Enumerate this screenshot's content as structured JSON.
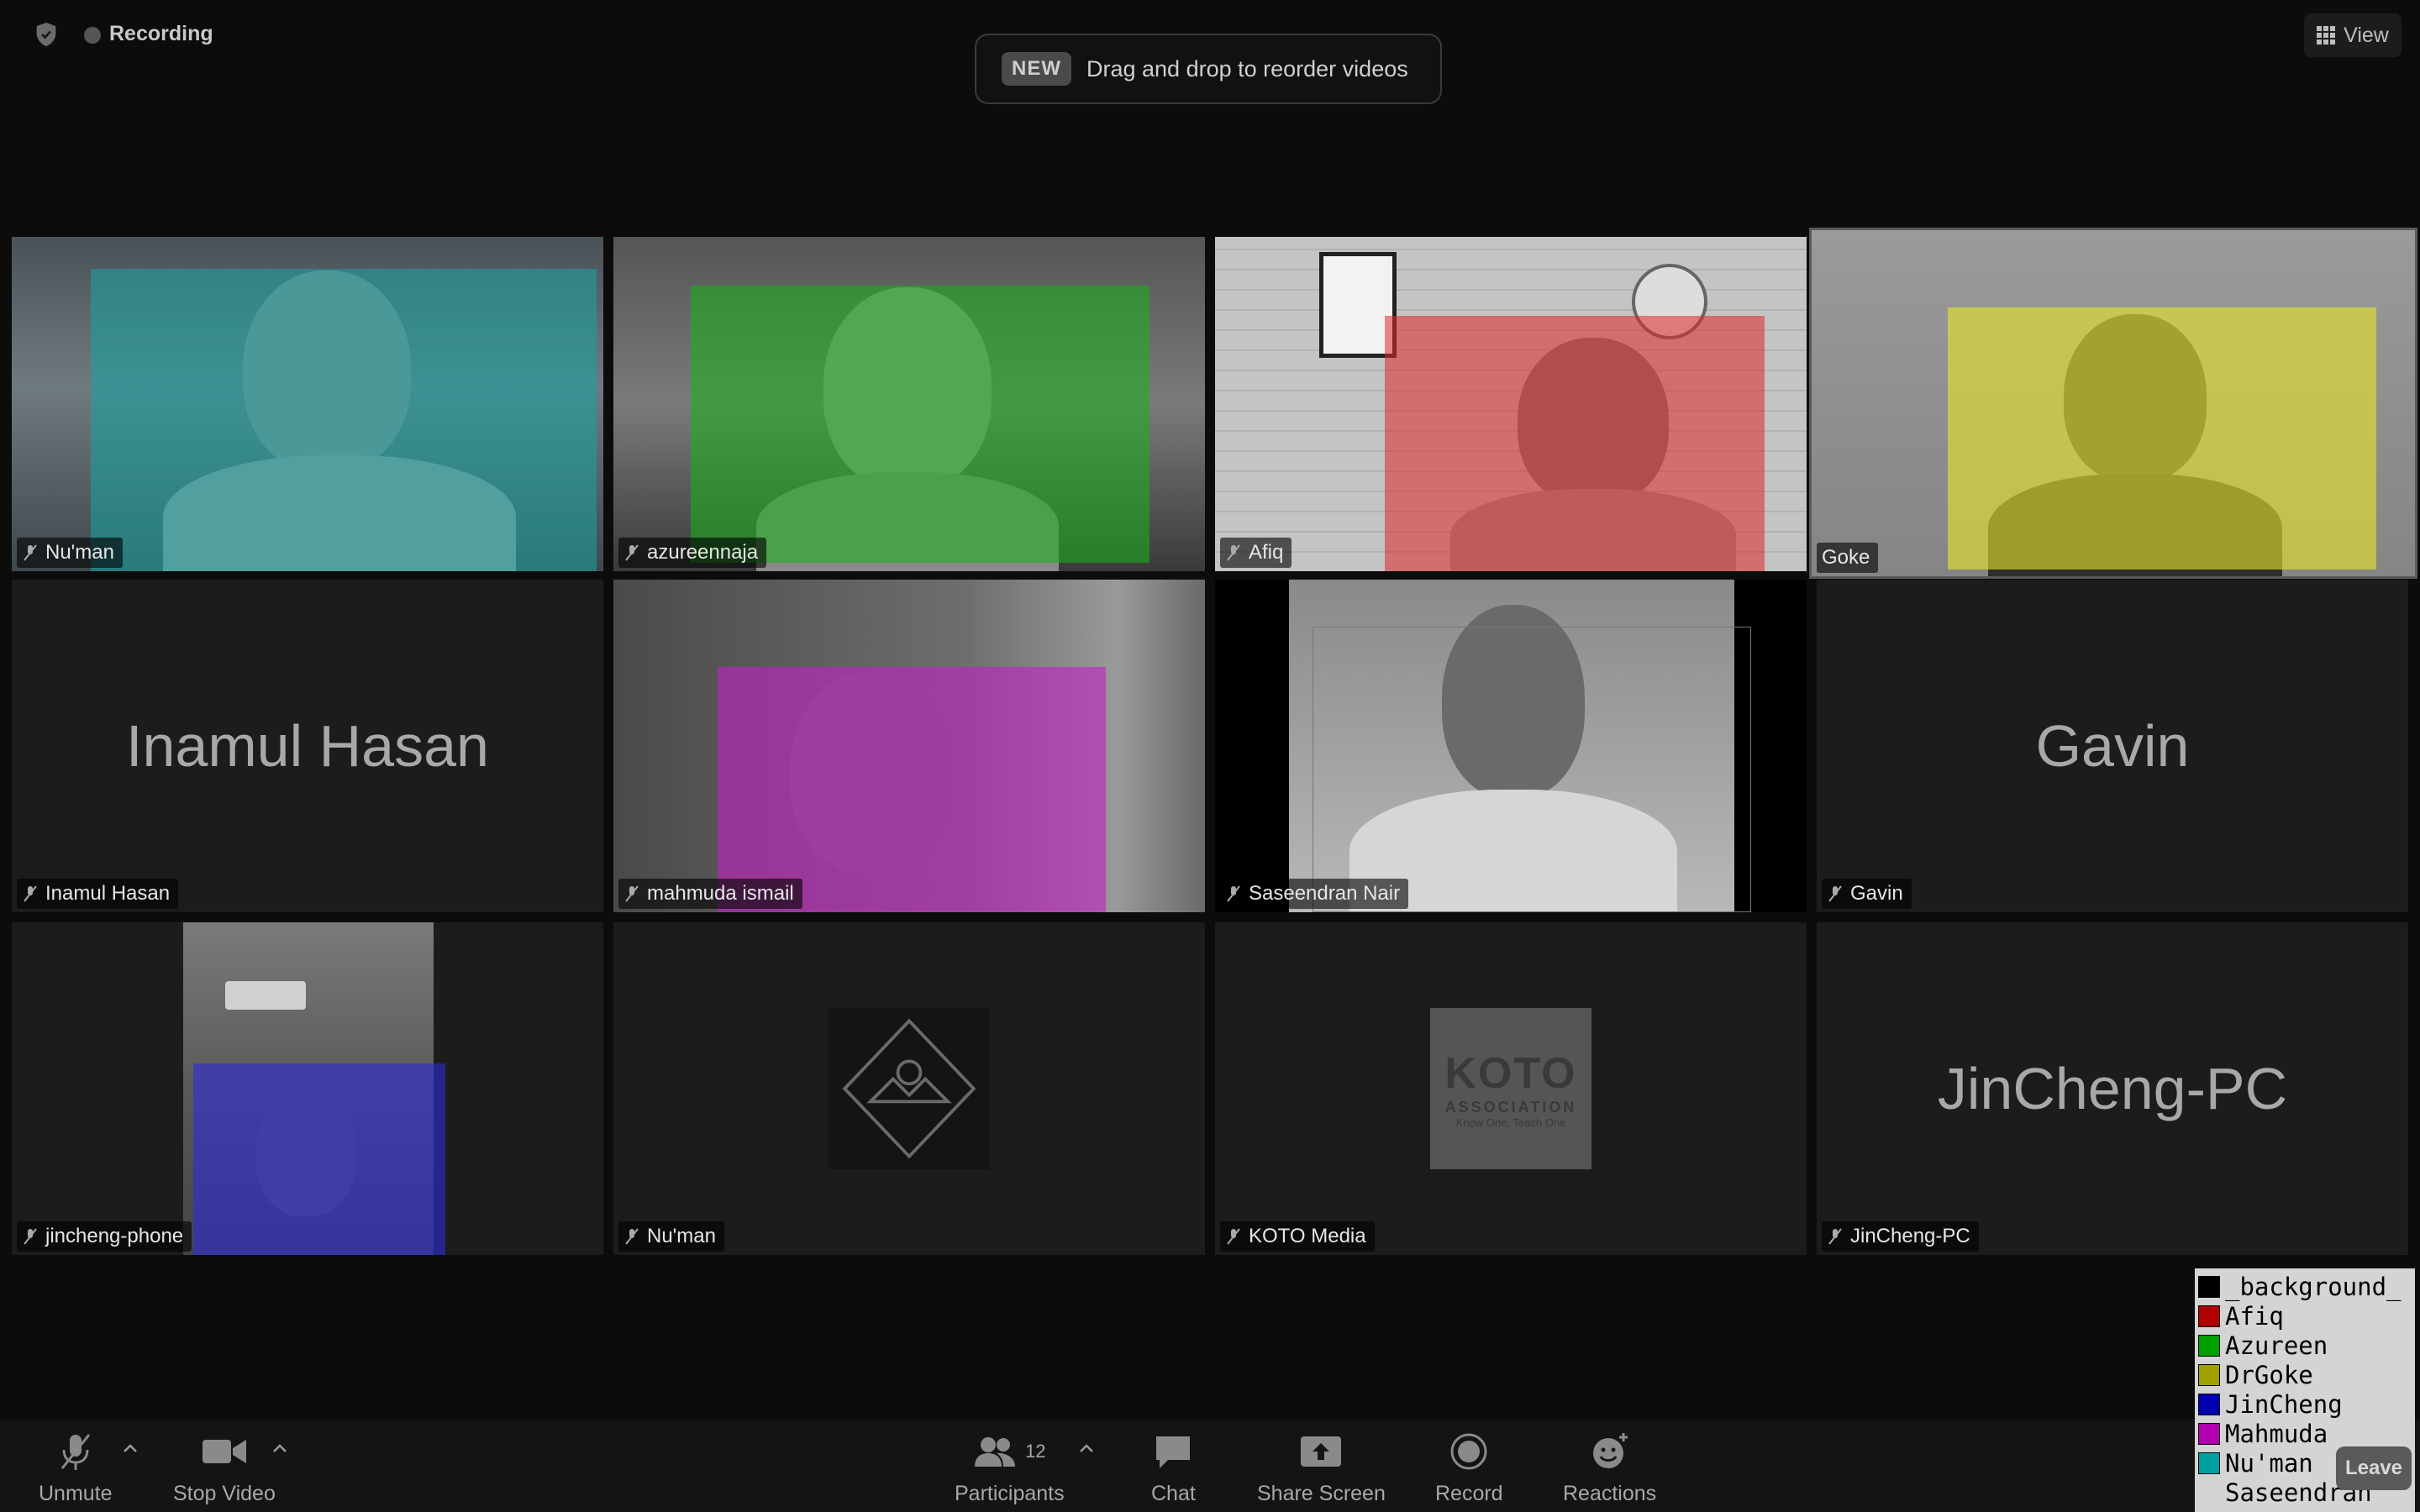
{
  "top_bar": {
    "recording_label": "Recording",
    "banner_badge": "NEW",
    "banner_text": "Drag and drop to reorder videos",
    "view_label": "View"
  },
  "tiles": [
    {
      "name": "Nu'man",
      "type": "video",
      "overlay_color": "#1aa3a3"
    },
    {
      "name": "azureennaja",
      "type": "video",
      "overlay_color": "#16b016"
    },
    {
      "name": "Afiq",
      "type": "video",
      "overlay_color": "#e02020"
    },
    {
      "name": "Goke",
      "type": "video",
      "overlay_color": "#e8e82a"
    },
    {
      "name": "Inamul Hasan",
      "type": "name-only",
      "display": "Inamul Hasan"
    },
    {
      "name": "mahmuda ismail",
      "type": "video",
      "overlay_color": "#c21fc2"
    },
    {
      "name": "Saseendran Nair",
      "type": "video"
    },
    {
      "name": "Gavin",
      "type": "name-only",
      "display": "Gavin"
    },
    {
      "name": "jincheng-phone",
      "type": "video",
      "overlay_color": "#2a2ad8"
    },
    {
      "name": "Nu'man",
      "type": "avatar"
    },
    {
      "name": "KOTO Media",
      "type": "avatar",
      "avatar_title": "KOTO",
      "avatar_sub": "ASSOCIATION",
      "avatar_tag": "Know One, Teach One"
    },
    {
      "name": "JinCheng-PC",
      "type": "name-only",
      "display": "JinCheng-PC"
    }
  ],
  "toolbar": {
    "unmute": "Unmute",
    "stop_video": "Stop Video",
    "participants": "Participants",
    "participants_count": "12",
    "chat": "Chat",
    "share_screen": "Share Screen",
    "record": "Record",
    "reactions": "Reactions",
    "leave": "Leave"
  },
  "legend": [
    {
      "label": "_background_",
      "color": "#000000"
    },
    {
      "label": "Afiq",
      "color": "#b00000"
    },
    {
      "label": "Azureen",
      "color": "#00a000"
    },
    {
      "label": "DrGoke",
      "color": "#a0a000"
    },
    {
      "label": "JinCheng",
      "color": "#0000b0"
    },
    {
      "label": "Mahmuda",
      "color": "#b000b0"
    },
    {
      "label": "Nu'man",
      "color": "#00a0a0"
    },
    {
      "label": "Saseendran",
      "color": "#d4d4d4"
    }
  ]
}
